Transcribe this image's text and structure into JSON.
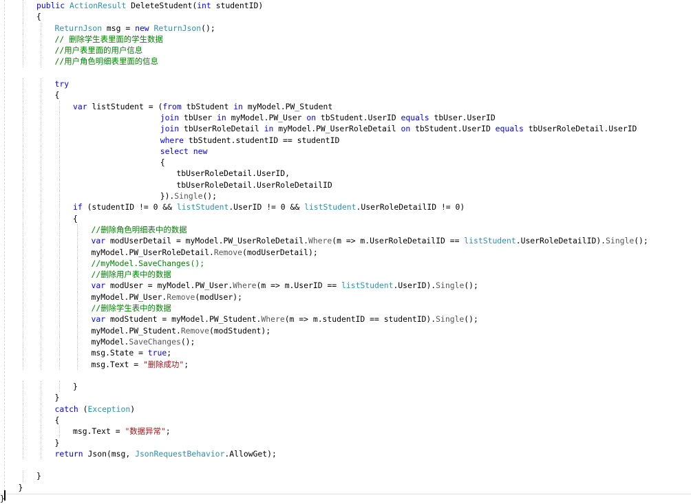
{
  "editor": {
    "language": "csharp",
    "colors": {
      "keyword": "#0000ff",
      "type": "#2b91af",
      "comment": "#008000",
      "string": "#a31515",
      "plain": "#000000"
    },
    "lines": [
      {
        "indent": 2,
        "tokens": [
          {
            "t": "public ",
            "c": "kw"
          },
          {
            "t": "ActionResult",
            "c": "cls"
          },
          {
            "t": " DeleteStudent(",
            "c": ""
          },
          {
            "t": "int",
            "c": "kw"
          },
          {
            "t": " studentID)",
            "c": ""
          }
        ]
      },
      {
        "indent": 2,
        "tokens": [
          {
            "t": "{",
            "c": ""
          }
        ]
      },
      {
        "indent": 3,
        "tokens": [
          {
            "t": "ReturnJson",
            "c": "cls"
          },
          {
            "t": " msg = ",
            "c": ""
          },
          {
            "t": "new ",
            "c": "kw"
          },
          {
            "t": "ReturnJson",
            "c": "cls"
          },
          {
            "t": "();",
            "c": ""
          }
        ]
      },
      {
        "indent": 3,
        "tokens": [
          {
            "t": "// 删除学生表里面的学生数据",
            "c": "cm"
          }
        ]
      },
      {
        "indent": 3,
        "tokens": [
          {
            "t": "//用户表里面的用户信息",
            "c": "cm"
          }
        ]
      },
      {
        "indent": 3,
        "tokens": [
          {
            "t": "//用户角色明细表里面的信息",
            "c": "cm"
          }
        ]
      },
      {
        "indent": 0,
        "tokens": []
      },
      {
        "indent": 3,
        "tokens": [
          {
            "t": "try",
            "c": "kw"
          }
        ]
      },
      {
        "indent": 3,
        "tokens": [
          {
            "t": "{",
            "c": ""
          }
        ]
      },
      {
        "indent": 4,
        "tokens": [
          {
            "t": "var ",
            "c": "kw"
          },
          {
            "t": "listStudent = (",
            "c": ""
          },
          {
            "t": "from ",
            "c": "kw"
          },
          {
            "t": "tbStudent ",
            "c": ""
          },
          {
            "t": "in ",
            "c": "kw"
          },
          {
            "t": "myModel.PW_Student",
            "c": ""
          }
        ]
      },
      {
        "indent": 0,
        "pad": 59,
        "tokens": [
          {
            "t": "join ",
            "c": "kw"
          },
          {
            "t": "tbUser ",
            "c": ""
          },
          {
            "t": "in ",
            "c": "kw"
          },
          {
            "t": "myModel.PW_User ",
            "c": ""
          },
          {
            "t": "on ",
            "c": "kw"
          },
          {
            "t": "tbStudent.UserID ",
            "c": ""
          },
          {
            "t": "equals ",
            "c": "kw"
          },
          {
            "t": "tbUser.UserID",
            "c": ""
          }
        ]
      },
      {
        "indent": 0,
        "pad": 59,
        "tokens": [
          {
            "t": "join ",
            "c": "kw"
          },
          {
            "t": "tbUserRoleDetail ",
            "c": ""
          },
          {
            "t": "in ",
            "c": "kw"
          },
          {
            "t": "myModel.PW_UserRoleDetail ",
            "c": ""
          },
          {
            "t": "on ",
            "c": "kw"
          },
          {
            "t": "tbStudent.UserID ",
            "c": ""
          },
          {
            "t": "equals ",
            "c": "kw"
          },
          {
            "t": "tbUserRoleDetail.UserID",
            "c": ""
          }
        ]
      },
      {
        "indent": 0,
        "pad": 59,
        "tokens": [
          {
            "t": "where ",
            "c": "kw"
          },
          {
            "t": "tbStudent.studentID == studentID",
            "c": ""
          }
        ]
      },
      {
        "indent": 0,
        "pad": 59,
        "tokens": [
          {
            "t": "select new",
            "c": "kw"
          }
        ]
      },
      {
        "indent": 0,
        "pad": 59,
        "tokens": [
          {
            "t": "{",
            "c": ""
          }
        ]
      },
      {
        "indent": 0,
        "pad": 65,
        "tokens": [
          {
            "t": "tbUserRoleDetail.UserID,",
            "c": ""
          }
        ]
      },
      {
        "indent": 0,
        "pad": 65,
        "tokens": [
          {
            "t": "tbUserRoleDetail.UserRoleDetailID",
            "c": ""
          }
        ]
      },
      {
        "indent": 0,
        "pad": 59,
        "tokens": [
          {
            "t": "}).",
            "c": ""
          },
          {
            "t": "Single",
            "c": "mth"
          },
          {
            "t": "();",
            "c": ""
          }
        ]
      },
      {
        "indent": 4,
        "tokens": [
          {
            "t": "if ",
            "c": "kw"
          },
          {
            "t": "(studentID != 0 && ",
            "c": ""
          },
          {
            "t": "listStudent",
            "c": "cls"
          },
          {
            "t": ".UserID != 0 && ",
            "c": ""
          },
          {
            "t": "listStudent",
            "c": "cls"
          },
          {
            "t": ".UserRoleDetailID != 0)",
            "c": ""
          }
        ]
      },
      {
        "indent": 4,
        "tokens": [
          {
            "t": "{",
            "c": ""
          }
        ]
      },
      {
        "indent": 5,
        "tokens": [
          {
            "t": "//删除角色明细表中的数据",
            "c": "cm"
          }
        ]
      },
      {
        "indent": 5,
        "tokens": [
          {
            "t": "var ",
            "c": "kw"
          },
          {
            "t": "modUserDetail = myModel.PW_UserRoleDetail.",
            "c": ""
          },
          {
            "t": "Where",
            "c": "mth"
          },
          {
            "t": "(m => m.UserRoleDetailID == ",
            "c": ""
          },
          {
            "t": "listStudent",
            "c": "cls"
          },
          {
            "t": ".UserRoleDetailID).",
            "c": ""
          },
          {
            "t": "Single",
            "c": "mth"
          },
          {
            "t": "();",
            "c": ""
          }
        ]
      },
      {
        "indent": 5,
        "tokens": [
          {
            "t": "myModel.PW_UserRoleDetail.",
            "c": ""
          },
          {
            "t": "Remove",
            "c": "mth"
          },
          {
            "t": "(modUserDetail);",
            "c": ""
          }
        ]
      },
      {
        "indent": 5,
        "tokens": [
          {
            "t": "//myModel.SaveChanges();",
            "c": "cm"
          }
        ]
      },
      {
        "indent": 5,
        "tokens": [
          {
            "t": "//删除用户表中的数据",
            "c": "cm"
          }
        ]
      },
      {
        "indent": 5,
        "tokens": [
          {
            "t": "var ",
            "c": "kw"
          },
          {
            "t": "modUser = myModel.PW_User.",
            "c": ""
          },
          {
            "t": "Where",
            "c": "mth"
          },
          {
            "t": "(m => m.UserID == ",
            "c": ""
          },
          {
            "t": "listStudent",
            "c": "cls"
          },
          {
            "t": ".UserID).",
            "c": ""
          },
          {
            "t": "Single",
            "c": "mth"
          },
          {
            "t": "();",
            "c": ""
          }
        ]
      },
      {
        "indent": 5,
        "tokens": [
          {
            "t": "myModel.PW_User.",
            "c": ""
          },
          {
            "t": "Remove",
            "c": "mth"
          },
          {
            "t": "(modUser);",
            "c": ""
          }
        ]
      },
      {
        "indent": 5,
        "tokens": [
          {
            "t": "//删除学生表中的数据",
            "c": "cm"
          }
        ]
      },
      {
        "indent": 5,
        "tokens": [
          {
            "t": "var ",
            "c": "kw"
          },
          {
            "t": "modStudent = myModel.PW_Student.",
            "c": ""
          },
          {
            "t": "Where",
            "c": "mth"
          },
          {
            "t": "(m => m.studentID == studentID).",
            "c": ""
          },
          {
            "t": "Single",
            "c": "mth"
          },
          {
            "t": "();",
            "c": ""
          }
        ]
      },
      {
        "indent": 5,
        "tokens": [
          {
            "t": "myModel.PW_Student.",
            "c": ""
          },
          {
            "t": "Remove",
            "c": "mth"
          },
          {
            "t": "(modStudent);",
            "c": ""
          }
        ]
      },
      {
        "indent": 5,
        "tokens": [
          {
            "t": "myModel.",
            "c": ""
          },
          {
            "t": "SaveChanges",
            "c": "mth"
          },
          {
            "t": "();",
            "c": ""
          }
        ]
      },
      {
        "indent": 5,
        "tokens": [
          {
            "t": "msg.State = ",
            "c": ""
          },
          {
            "t": "true",
            "c": "kw"
          },
          {
            "t": ";",
            "c": ""
          }
        ]
      },
      {
        "indent": 5,
        "tokens": [
          {
            "t": "msg.Text = ",
            "c": ""
          },
          {
            "t": "\"删除成功\"",
            "c": "str"
          },
          {
            "t": ";",
            "c": ""
          }
        ]
      },
      {
        "indent": 0,
        "tokens": []
      },
      {
        "indent": 4,
        "tokens": [
          {
            "t": "}",
            "c": ""
          }
        ]
      },
      {
        "indent": 3,
        "tokens": [
          {
            "t": "}",
            "c": ""
          }
        ]
      },
      {
        "indent": 3,
        "tokens": [
          {
            "t": "catch ",
            "c": "kw"
          },
          {
            "t": "(",
            "c": ""
          },
          {
            "t": "Exception",
            "c": "cls"
          },
          {
            "t": ")",
            "c": ""
          }
        ]
      },
      {
        "indent": 3,
        "tokens": [
          {
            "t": "{",
            "c": ""
          }
        ]
      },
      {
        "indent": 4,
        "tokens": [
          {
            "t": "msg.Text = ",
            "c": ""
          },
          {
            "t": "\"数据异常\"",
            "c": "str"
          },
          {
            "t": ";",
            "c": ""
          }
        ]
      },
      {
        "indent": 3,
        "tokens": [
          {
            "t": "}",
            "c": ""
          }
        ]
      },
      {
        "indent": 3,
        "tokens": [
          {
            "t": "return ",
            "c": "kw"
          },
          {
            "t": "Json(msg, ",
            "c": ""
          },
          {
            "t": "JsonRequestBehavior",
            "c": "cls"
          },
          {
            "t": ".AllowGet);",
            "c": ""
          }
        ]
      },
      {
        "indent": 0,
        "tokens": []
      },
      {
        "indent": 2,
        "tokens": [
          {
            "t": "}",
            "c": ""
          }
        ]
      },
      {
        "indent": 1,
        "tokens": [
          {
            "t": "}",
            "c": ""
          }
        ]
      },
      {
        "indent": 0,
        "tokens": [
          {
            "t": "}",
            "c": ""
          }
        ]
      }
    ]
  }
}
